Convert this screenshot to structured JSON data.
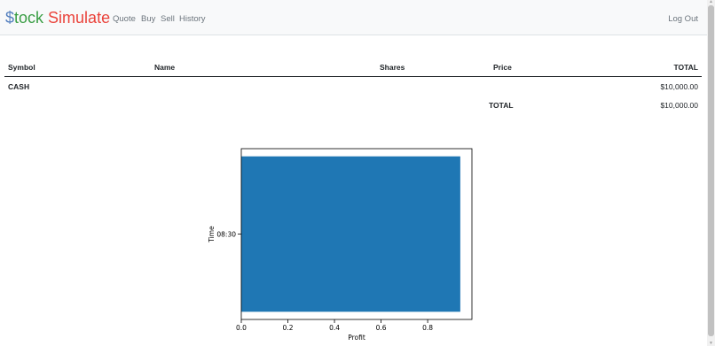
{
  "navbar": {
    "brand": {
      "dollar": "$",
      "part1": "tock",
      "part2": "Simulate"
    },
    "links": [
      "Quote",
      "Buy",
      "Sell",
      "History"
    ],
    "logout": "Log Out"
  },
  "table": {
    "headers": {
      "symbol": "Symbol",
      "name": "Name",
      "shares": "Shares",
      "price": "Price",
      "total": "TOTAL"
    },
    "rows": [
      {
        "symbol": "CASH",
        "total": "$10,000.00"
      }
    ],
    "footer": {
      "label": "TOTAL",
      "value": "$10,000.00"
    }
  },
  "chart_data": {
    "type": "bar",
    "orientation": "horizontal",
    "categories": [
      "08:30"
    ],
    "values": [
      0.94
    ],
    "xlabel": "Profit",
    "ylabel": "Time",
    "xlim": [
      0,
      0.99
    ],
    "xticks": [
      "0.0",
      "0.2",
      "0.4",
      "0.6",
      "0.8"
    ],
    "bar_color": "#1f77b4",
    "grid": false
  },
  "colors": {
    "brand_dollar": "#537fbe",
    "brand_tock": "#3a9e45",
    "brand_simulate": "#ea433b",
    "bar": "#1f77b4"
  }
}
